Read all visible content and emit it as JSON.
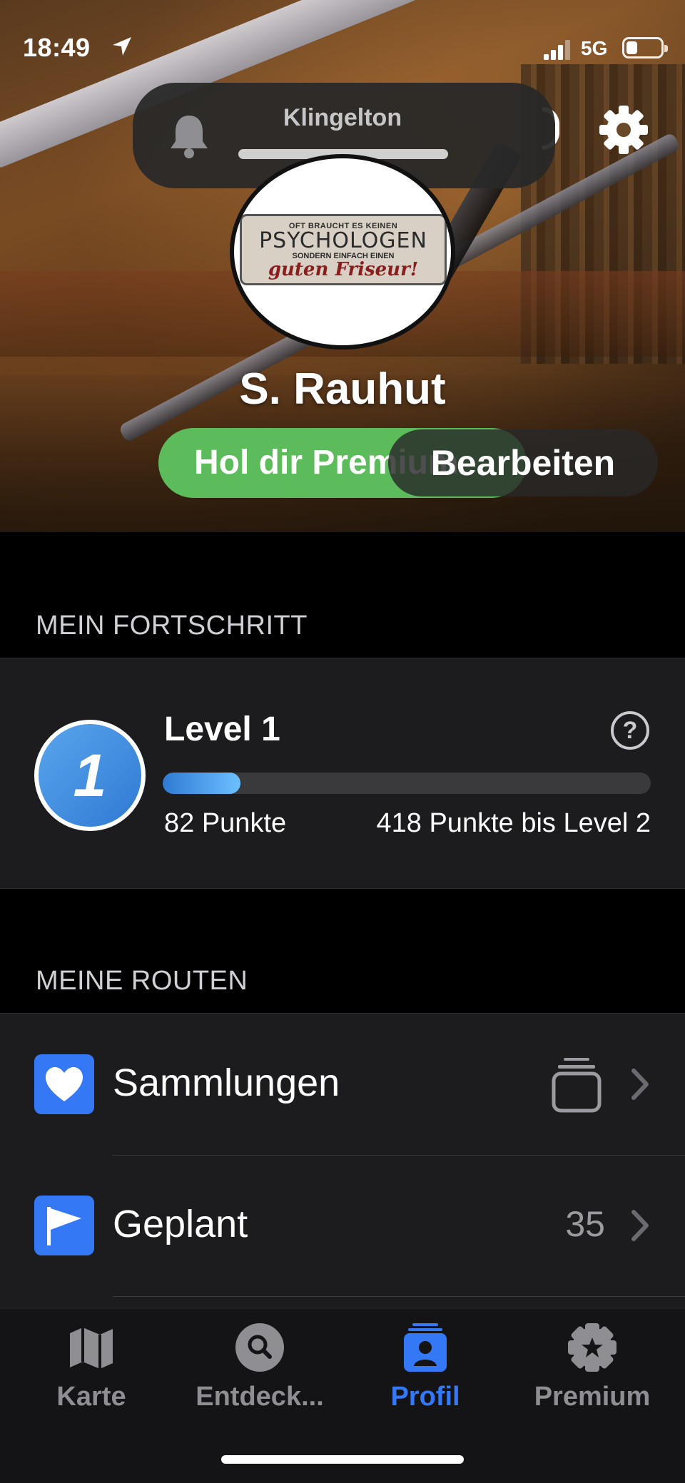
{
  "status_bar": {
    "time": "18:49",
    "network": "5G",
    "battery_percent": 20
  },
  "ringer_hud": {
    "label": "Klingelton",
    "volume": 1.0
  },
  "profile": {
    "username": "S. Rauhut",
    "avatar_sign": {
      "line1": "OFT BRAUCHT ES KEINEN",
      "line2": "PSYCHOLOGEN",
      "line3": "SONDERN EINFACH EINEN",
      "line4": "guten Friseur!"
    },
    "premium_button_label": "Hol dir Premium",
    "edit_button_label": "Bearbeiten"
  },
  "progress": {
    "section_title": "MEIN FORTSCHRITT",
    "level_number": "1",
    "level_title": "Level 1",
    "help_glyph": "?",
    "points_label": "82 Punkte",
    "remaining_label": "418 Punkte bis Level 2",
    "fill_fraction": 0.16
  },
  "routes": {
    "section_title": "MEINE ROUTEN",
    "items": [
      {
        "label": "Sammlungen",
        "icon": "heart-icon",
        "value": ""
      },
      {
        "label": "Geplant",
        "icon": "flag-icon",
        "value": "35"
      }
    ]
  },
  "tabbar": {
    "tabs": [
      {
        "label": "Karte",
        "icon": "map-icon",
        "active": false
      },
      {
        "label": "Entdeck...",
        "icon": "search-icon",
        "active": false
      },
      {
        "label": "Profil",
        "icon": "profile-icon",
        "active": true
      },
      {
        "label": "Premium",
        "icon": "star-badge-icon",
        "active": false
      }
    ]
  },
  "colors": {
    "accent": "#3478f6",
    "premium_green": "#5cbb5a",
    "card_bg": "#1c1c1e"
  }
}
